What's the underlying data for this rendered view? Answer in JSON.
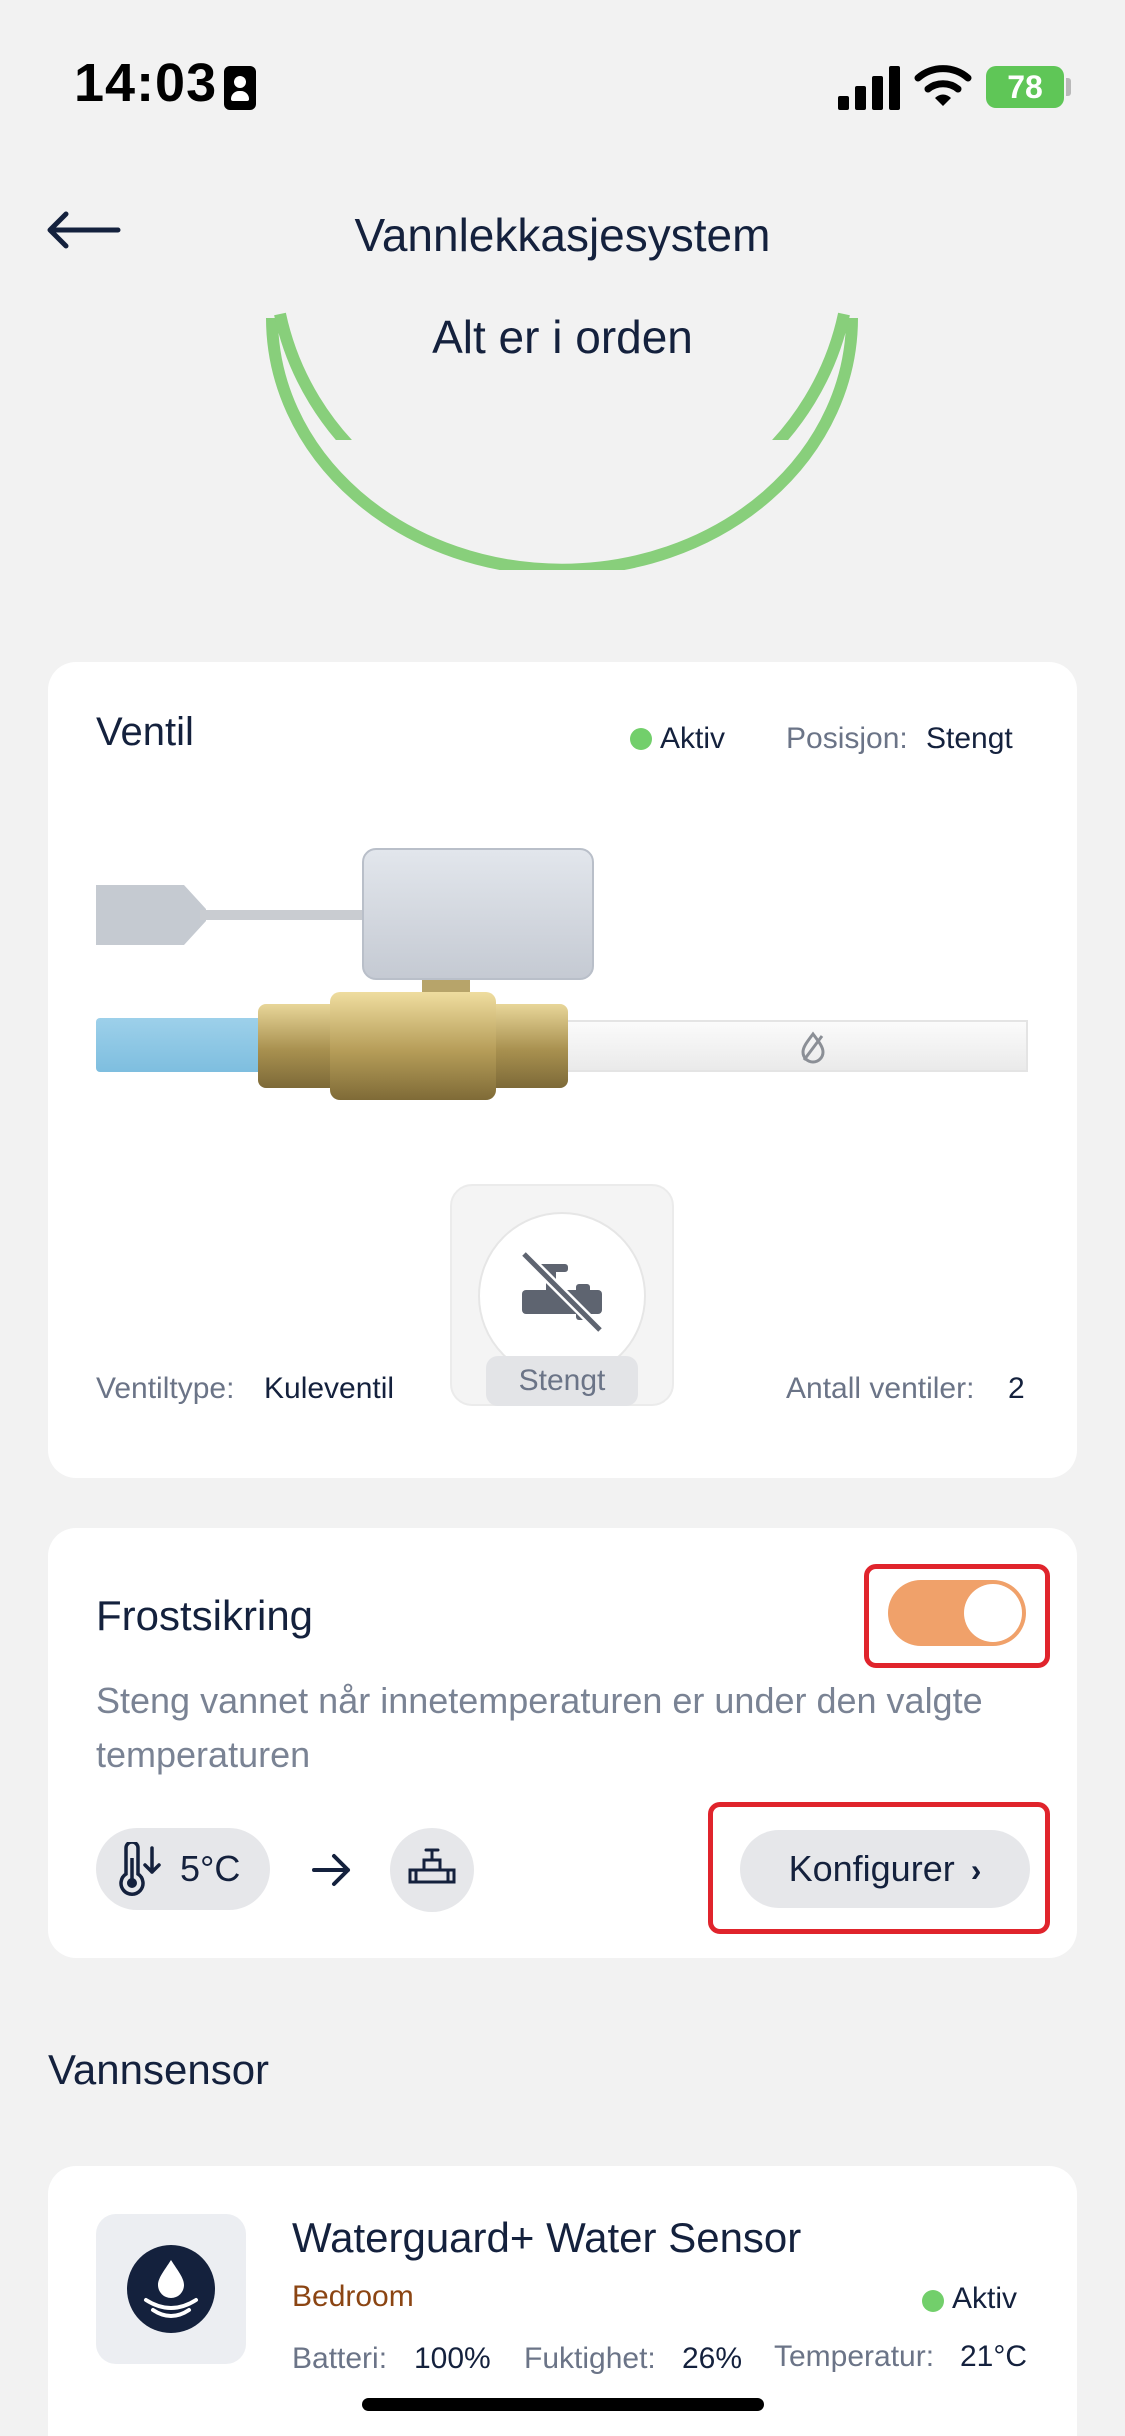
{
  "status_bar": {
    "time": "14:03",
    "battery": "78"
  },
  "header": {
    "title": "Vannlekkasjesystem",
    "status_message": "Alt er i orden"
  },
  "valve": {
    "title": "Ventil",
    "state": "Aktiv",
    "position_label": "Posisjon:",
    "position_value": "Stengt",
    "type_label": "Ventiltype:",
    "type_value": "Kuleventil",
    "count_label": "Antall ventiler:",
    "count_value": "2",
    "button_label": "Stengt"
  },
  "frost": {
    "title": "Frostsikring",
    "description": "Steng vannet når innetemperaturen er under den valgte temperaturen",
    "enabled": true,
    "temperature": "5°C",
    "configure_label": "Konfigurer"
  },
  "sensors": {
    "section_title": "Vannsensor",
    "items": [
      {
        "name": "Waterguard+ Water Sensor",
        "room": "Bedroom",
        "state": "Aktiv",
        "battery_label": "Batteri:",
        "battery_value": "100%",
        "humidity_label": "Fuktighet:",
        "humidity_value": "26%",
        "temperature_label": "Temperatur:",
        "temperature_value": "21°C"
      }
    ]
  },
  "colors": {
    "ok_green": "#72cf6b",
    "toggle_on": "#f0a16a",
    "highlight_red": "#e0242c",
    "text_dark": "#14213d"
  },
  "icons": [
    "id-badge-icon",
    "signal-icon",
    "wifi-icon",
    "battery-icon",
    "back-arrow-icon",
    "no-flow-icon",
    "valve-closed-icon",
    "thermometer-down-icon",
    "arrow-right-icon",
    "tap-icon",
    "chevron-right-icon",
    "water-drop-icon"
  ]
}
